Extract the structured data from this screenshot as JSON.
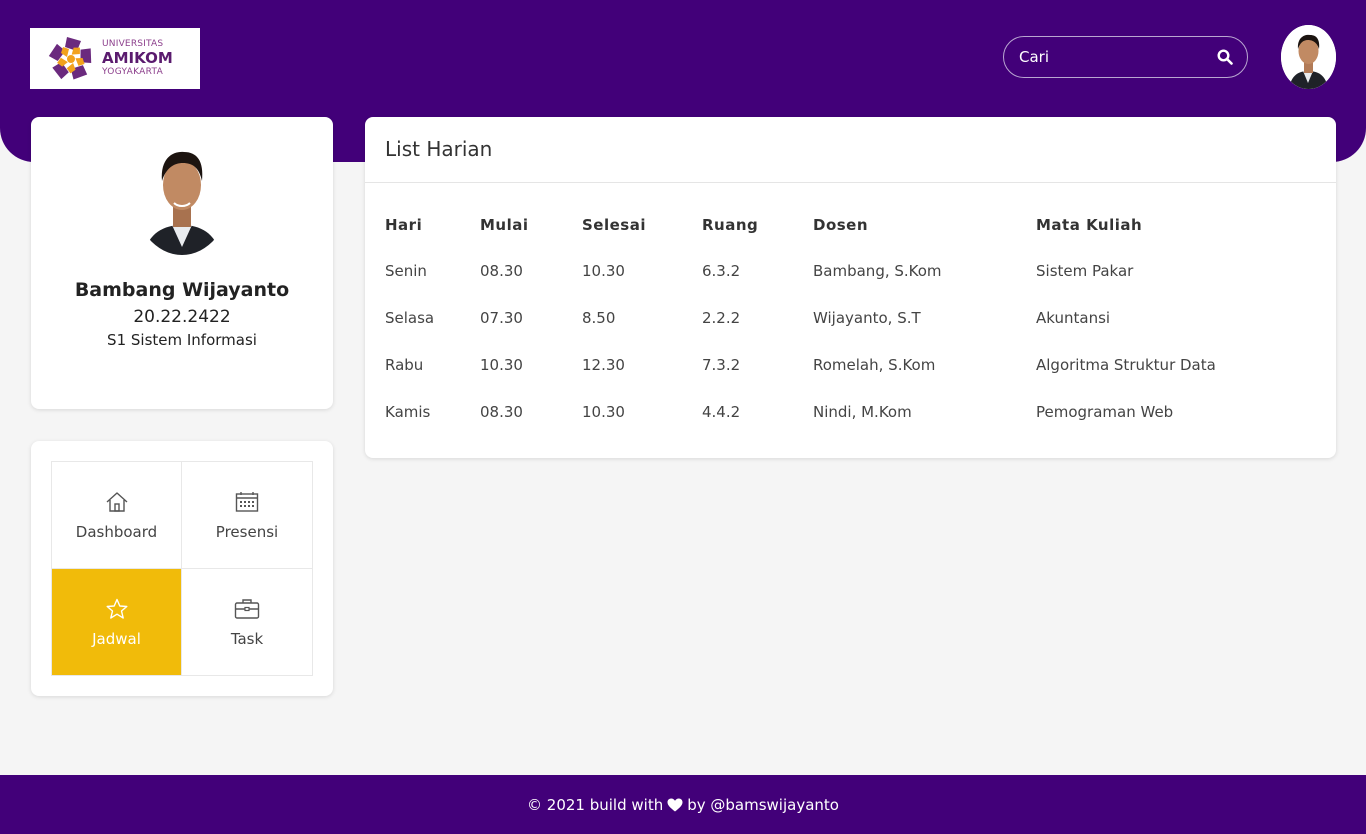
{
  "header": {
    "logo": {
      "line1": "UNIVERSITAS",
      "line2": "AMIKOM",
      "line3": "YOGYAKARTA",
      "colors": {
        "orange": "#f2a21c",
        "purple": "#6b2a7e"
      }
    },
    "search": {
      "placeholder": "Cari",
      "icon": "search-icon"
    },
    "avatar": {
      "icon": "user-avatar"
    }
  },
  "profile": {
    "name": "Bambang Wijayanto",
    "nim": "20.22.2422",
    "prodi": "S1 Sistem Informasi"
  },
  "menu": {
    "items": [
      {
        "label": "Dashboard",
        "icon": "home-icon",
        "active": false
      },
      {
        "label": "Presensi",
        "icon": "calendar-icon",
        "active": false
      },
      {
        "label": "Jadwal",
        "icon": "star-icon",
        "active": true
      },
      {
        "label": "Task",
        "icon": "briefcase-icon",
        "active": false
      }
    ],
    "active_color": "#f1bb0a"
  },
  "schedule": {
    "title": "List Harian",
    "columns": [
      "Hari",
      "Mulai",
      "Selesai",
      "Ruang",
      "Dosen",
      "Mata Kuliah"
    ],
    "rows": [
      [
        "Senin",
        "08.30",
        "10.30",
        "6.3.2",
        "Bambang, S.Kom",
        "Sistem Pakar"
      ],
      [
        "Selasa",
        "07.30",
        "8.50",
        "2.2.2",
        "Wijayanto, S.T",
        "Akuntansi"
      ],
      [
        "Rabu",
        "10.30",
        "12.30",
        "7.3.2",
        "Romelah, S.Kom",
        "Algoritma Struktur Data"
      ],
      [
        "Kamis",
        "08.30",
        "10.30",
        "4.4.2",
        "Nindi, M.Kom",
        "Pemograman Web"
      ]
    ]
  },
  "footer": {
    "prefix": "© 2021 build with",
    "icon": "heart-icon",
    "suffix": "by @bamswijayanto"
  },
  "theme": {
    "primary": "#420079",
    "background": "#f5f5f5"
  }
}
